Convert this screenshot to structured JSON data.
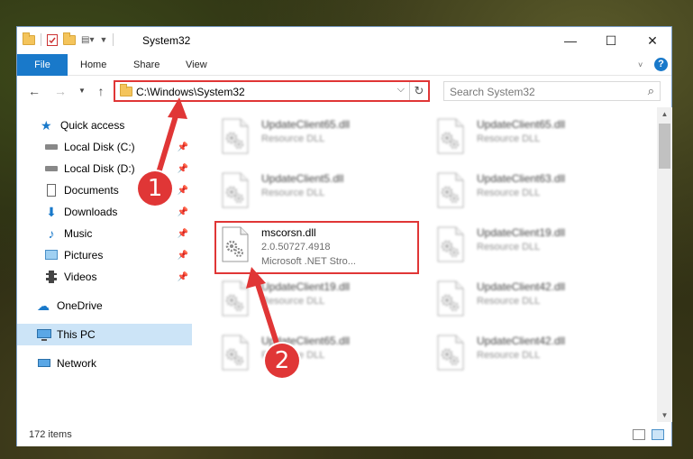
{
  "window": {
    "title": "System32",
    "controls": {
      "minimize": "—",
      "maximize": "☐",
      "close": "✕"
    }
  },
  "ribbon": {
    "tabs": [
      "File",
      "Home",
      "Share",
      "View"
    ],
    "expand_icon": "chevron-down-icon",
    "help_icon": "help-icon",
    "help_label": "?"
  },
  "address": {
    "path": "C:\\Windows\\System32",
    "search_placeholder": "Search System32"
  },
  "sidebar": {
    "items": [
      {
        "label": "Quick access",
        "icon": "star-icon",
        "pinned": false
      },
      {
        "label": "Local Disk (C:)",
        "icon": "drive-icon",
        "pinned": true
      },
      {
        "label": "Local Disk (D:)",
        "icon": "drive-icon",
        "pinned": true
      },
      {
        "label": "Documents",
        "icon": "documents-icon",
        "pinned": true
      },
      {
        "label": "Downloads",
        "icon": "download-icon",
        "pinned": true
      },
      {
        "label": "Music",
        "icon": "music-icon",
        "pinned": true
      },
      {
        "label": "Pictures",
        "icon": "pictures-icon",
        "pinned": true
      },
      {
        "label": "Videos",
        "icon": "videos-icon",
        "pinned": true
      },
      {
        "label": "OneDrive",
        "icon": "cloud-icon",
        "pinned": false
      },
      {
        "label": "This PC",
        "icon": "computer-icon",
        "pinned": false,
        "selected": true
      },
      {
        "label": "Network",
        "icon": "network-icon",
        "pinned": false
      }
    ]
  },
  "files": {
    "left": [
      {
        "name": "UpdateClient65.dll",
        "line2": "Resource DLL",
        "line3": "",
        "blurred": true
      },
      {
        "name": "UpdateClient5.dll",
        "line2": "Resource DLL",
        "line3": "",
        "blurred": true
      },
      {
        "name": "mscorsn.dll",
        "line2": "2.0.50727.4918",
        "line3": "Microsoft .NET Stro...",
        "blurred": false
      },
      {
        "name": "UpdateClient19.dll",
        "line2": "Resource DLL",
        "line3": "",
        "blurred": true
      },
      {
        "name": "UpdateClient65.dll",
        "line2": "Resource DLL",
        "line3": "",
        "blurred": true
      }
    ],
    "right": [
      {
        "name": "UpdateClient65.dll",
        "line2": "Resource DLL",
        "blurred": true
      },
      {
        "name": "UpdateClient63.dll",
        "line2": "Resource DLL",
        "blurred": true
      },
      {
        "name": "UpdateClient19.dll",
        "line2": "Resource DLL",
        "blurred": true
      },
      {
        "name": "UpdateClient42.dll",
        "line2": "Resource DLL",
        "blurred": true
      },
      {
        "name": "UpdateClient42.dll",
        "line2": "Resource DLL",
        "blurred": true
      }
    ]
  },
  "status": {
    "count": "172 items"
  },
  "annotations": {
    "step1": "1",
    "step2": "2",
    "color": "#e03636"
  }
}
